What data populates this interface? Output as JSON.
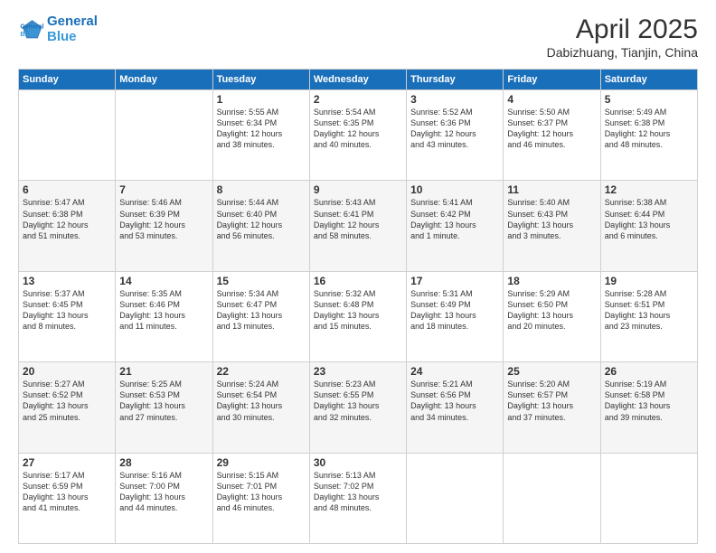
{
  "logo": {
    "line1": "General",
    "line2": "Blue"
  },
  "header": {
    "title": "April 2025",
    "subtitle": "Dabizhuang, Tianjin, China"
  },
  "weekdays": [
    "Sunday",
    "Monday",
    "Tuesday",
    "Wednesday",
    "Thursday",
    "Friday",
    "Saturday"
  ],
  "weeks": [
    [
      {
        "day": "",
        "info": ""
      },
      {
        "day": "",
        "info": ""
      },
      {
        "day": "1",
        "info": "Sunrise: 5:55 AM\nSunset: 6:34 PM\nDaylight: 12 hours\nand 38 minutes."
      },
      {
        "day": "2",
        "info": "Sunrise: 5:54 AM\nSunset: 6:35 PM\nDaylight: 12 hours\nand 40 minutes."
      },
      {
        "day": "3",
        "info": "Sunrise: 5:52 AM\nSunset: 6:36 PM\nDaylight: 12 hours\nand 43 minutes."
      },
      {
        "day": "4",
        "info": "Sunrise: 5:50 AM\nSunset: 6:37 PM\nDaylight: 12 hours\nand 46 minutes."
      },
      {
        "day": "5",
        "info": "Sunrise: 5:49 AM\nSunset: 6:38 PM\nDaylight: 12 hours\nand 48 minutes."
      }
    ],
    [
      {
        "day": "6",
        "info": "Sunrise: 5:47 AM\nSunset: 6:38 PM\nDaylight: 12 hours\nand 51 minutes."
      },
      {
        "day": "7",
        "info": "Sunrise: 5:46 AM\nSunset: 6:39 PM\nDaylight: 12 hours\nand 53 minutes."
      },
      {
        "day": "8",
        "info": "Sunrise: 5:44 AM\nSunset: 6:40 PM\nDaylight: 12 hours\nand 56 minutes."
      },
      {
        "day": "9",
        "info": "Sunrise: 5:43 AM\nSunset: 6:41 PM\nDaylight: 12 hours\nand 58 minutes."
      },
      {
        "day": "10",
        "info": "Sunrise: 5:41 AM\nSunset: 6:42 PM\nDaylight: 13 hours\nand 1 minute."
      },
      {
        "day": "11",
        "info": "Sunrise: 5:40 AM\nSunset: 6:43 PM\nDaylight: 13 hours\nand 3 minutes."
      },
      {
        "day": "12",
        "info": "Sunrise: 5:38 AM\nSunset: 6:44 PM\nDaylight: 13 hours\nand 6 minutes."
      }
    ],
    [
      {
        "day": "13",
        "info": "Sunrise: 5:37 AM\nSunset: 6:45 PM\nDaylight: 13 hours\nand 8 minutes."
      },
      {
        "day": "14",
        "info": "Sunrise: 5:35 AM\nSunset: 6:46 PM\nDaylight: 13 hours\nand 11 minutes."
      },
      {
        "day": "15",
        "info": "Sunrise: 5:34 AM\nSunset: 6:47 PM\nDaylight: 13 hours\nand 13 minutes."
      },
      {
        "day": "16",
        "info": "Sunrise: 5:32 AM\nSunset: 6:48 PM\nDaylight: 13 hours\nand 15 minutes."
      },
      {
        "day": "17",
        "info": "Sunrise: 5:31 AM\nSunset: 6:49 PM\nDaylight: 13 hours\nand 18 minutes."
      },
      {
        "day": "18",
        "info": "Sunrise: 5:29 AM\nSunset: 6:50 PM\nDaylight: 13 hours\nand 20 minutes."
      },
      {
        "day": "19",
        "info": "Sunrise: 5:28 AM\nSunset: 6:51 PM\nDaylight: 13 hours\nand 23 minutes."
      }
    ],
    [
      {
        "day": "20",
        "info": "Sunrise: 5:27 AM\nSunset: 6:52 PM\nDaylight: 13 hours\nand 25 minutes."
      },
      {
        "day": "21",
        "info": "Sunrise: 5:25 AM\nSunset: 6:53 PM\nDaylight: 13 hours\nand 27 minutes."
      },
      {
        "day": "22",
        "info": "Sunrise: 5:24 AM\nSunset: 6:54 PM\nDaylight: 13 hours\nand 30 minutes."
      },
      {
        "day": "23",
        "info": "Sunrise: 5:23 AM\nSunset: 6:55 PM\nDaylight: 13 hours\nand 32 minutes."
      },
      {
        "day": "24",
        "info": "Sunrise: 5:21 AM\nSunset: 6:56 PM\nDaylight: 13 hours\nand 34 minutes."
      },
      {
        "day": "25",
        "info": "Sunrise: 5:20 AM\nSunset: 6:57 PM\nDaylight: 13 hours\nand 37 minutes."
      },
      {
        "day": "26",
        "info": "Sunrise: 5:19 AM\nSunset: 6:58 PM\nDaylight: 13 hours\nand 39 minutes."
      }
    ],
    [
      {
        "day": "27",
        "info": "Sunrise: 5:17 AM\nSunset: 6:59 PM\nDaylight: 13 hours\nand 41 minutes."
      },
      {
        "day": "28",
        "info": "Sunrise: 5:16 AM\nSunset: 7:00 PM\nDaylight: 13 hours\nand 44 minutes."
      },
      {
        "day": "29",
        "info": "Sunrise: 5:15 AM\nSunset: 7:01 PM\nDaylight: 13 hours\nand 46 minutes."
      },
      {
        "day": "30",
        "info": "Sunrise: 5:13 AM\nSunset: 7:02 PM\nDaylight: 13 hours\nand 48 minutes."
      },
      {
        "day": "",
        "info": ""
      },
      {
        "day": "",
        "info": ""
      },
      {
        "day": "",
        "info": ""
      }
    ]
  ]
}
